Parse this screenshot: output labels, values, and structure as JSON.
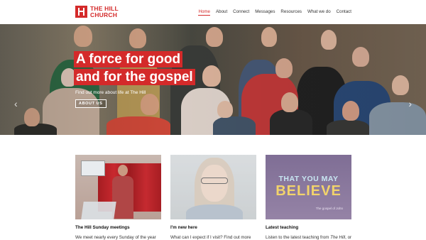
{
  "logo": {
    "line1": "THE HILL",
    "line2": "CHURCH"
  },
  "nav": [
    "Home",
    "About",
    "Connect",
    "Messages",
    "Resources",
    "What we do",
    "Contact"
  ],
  "hero": {
    "title_line1": "A force for good",
    "title_line2": "and for the gospel",
    "subtitle": "Find out more about life at The Hill",
    "button": "ABOUT US",
    "prev_arrow": "‹",
    "next_arrow": "›"
  },
  "cards": [
    {
      "title": "The Hill Sunday meetings",
      "text": "We meet nearly every Sunday of the year"
    },
    {
      "title": "I'm new here",
      "text": "What can I expect if I visit? Find out more"
    },
    {
      "title": "Latest teaching",
      "text_prefix": "Listen to the latest teaching from ",
      "text_em": "The Hill",
      "text_suffix": ", or",
      "image_line1": "THAT YOU MAY",
      "image_line2": "BELIEVE",
      "image_caption": "The gospel of John"
    }
  ],
  "colors": {
    "accent": "#d42a2a"
  }
}
